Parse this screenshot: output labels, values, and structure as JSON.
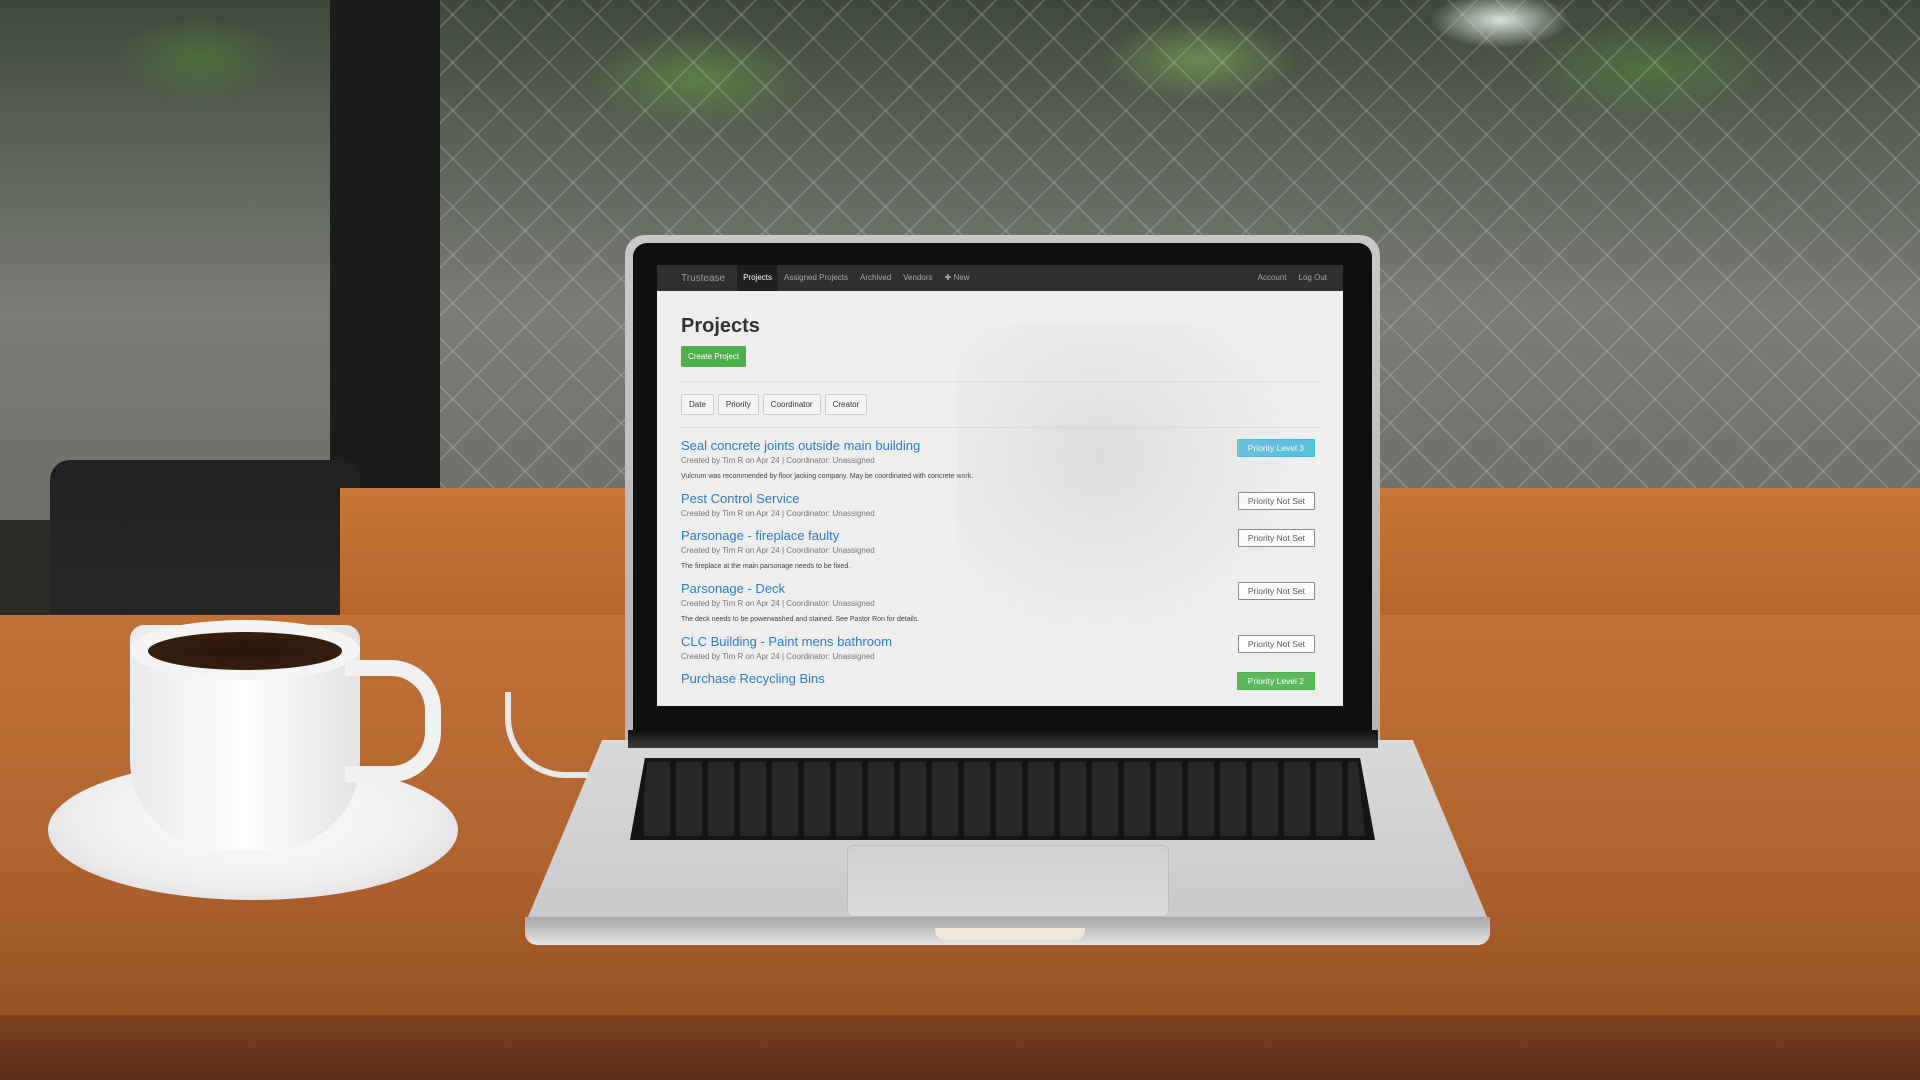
{
  "nav": {
    "brand": "Trustease",
    "items": [
      {
        "label": "Projects",
        "active": true
      },
      {
        "label": "Assigned Projects",
        "active": false
      },
      {
        "label": "Archived",
        "active": false
      },
      {
        "label": "Vendors",
        "active": false
      },
      {
        "label": "New",
        "active": false,
        "icon": "plus-circle-icon"
      }
    ],
    "right": [
      "Account",
      "Log Out"
    ]
  },
  "page": {
    "title": "Projects",
    "create_button": "Create Project"
  },
  "filters": [
    "Date",
    "Priority",
    "Coordinator",
    "Creator"
  ],
  "projects": [
    {
      "title": "Seal concrete joints outside main building",
      "meta": "Created by Tim R on Apr 24 | Coordinator: Unassigned",
      "description": "Vulcrum was recommended by floor jacking company. May be coordinated with concrete work.",
      "priority": "Priority Level 3"
    },
    {
      "title": "Pest Control Service",
      "meta": "Created by Tim R on Apr 24 | Coordinator: Unassigned",
      "description": "",
      "priority": "Priority Not Set"
    },
    {
      "title": "Parsonage - fireplace faulty",
      "meta": "Created by Tim R on Apr 24 | Coordinator: Unassigned",
      "description": "The fireplace at the main parsonage needs to be fixed.",
      "priority": "Priority Not Set"
    },
    {
      "title": "Parsonage - Deck",
      "meta": "Created by Tim R on Apr 24 | Coordinator: Unassigned",
      "description": "The deck needs to be powerwashed and stained. See Pastor Ron for details.",
      "priority": "Priority Not Set"
    },
    {
      "title": "CLC Building - Paint mens bathroom",
      "meta": "Created by Tim R on Apr 24 | Coordinator: Unassigned",
      "description": "",
      "priority": "Priority Not Set"
    },
    {
      "title": "Purchase Recycling Bins",
      "meta": "",
      "description": "",
      "priority": "Priority Level 2"
    }
  ],
  "colors": {
    "link": "#2f7abf",
    "navbar": "#2f2f2f",
    "success": "#5cb85c",
    "info": "#5bc0de"
  }
}
